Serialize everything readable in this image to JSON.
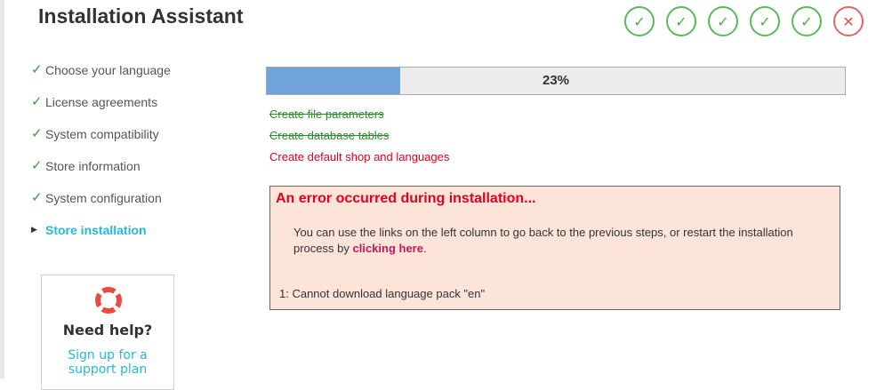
{
  "header": {
    "title": "Installation Assistant"
  },
  "step_icons": [
    {
      "icon": "check-circle-icon",
      "glyph": "✓",
      "status": "done"
    },
    {
      "icon": "check-circle-icon",
      "glyph": "✓",
      "status": "done"
    },
    {
      "icon": "check-circle-icon",
      "glyph": "✓",
      "status": "done"
    },
    {
      "icon": "check-circle-icon",
      "glyph": "✓",
      "status": "done"
    },
    {
      "icon": "check-circle-icon",
      "glyph": "✓",
      "status": "done"
    },
    {
      "icon": "close-circle-icon",
      "glyph": "✕",
      "status": "error"
    }
  ],
  "sidebar": {
    "steps": [
      {
        "label": "Choose your language",
        "status": "done"
      },
      {
        "label": "License agreements",
        "status": "done"
      },
      {
        "label": "System compatibility",
        "status": "done"
      },
      {
        "label": "Store information",
        "status": "done"
      },
      {
        "label": "System configuration",
        "status": "done"
      },
      {
        "label": "Store installation",
        "status": "active"
      }
    ]
  },
  "help": {
    "title": "Need help?",
    "link_line1": "Sign up for a",
    "link_line2": "support plan"
  },
  "progress": {
    "fraction": 0.23,
    "label": "23%"
  },
  "tasks": [
    {
      "label": "Create file parameters",
      "status": "done"
    },
    {
      "label": "Create database tables",
      "status": "done"
    },
    {
      "label": "Create default shop and languages",
      "status": "failed"
    }
  ],
  "error": {
    "title": "An error occurred during installation...",
    "message": "You can use the links on the left column to go back to the previous steps, or restart the installation process by",
    "link_text": "clicking here",
    "message_end": ".",
    "detail": "1: Cannot download language pack \"en\""
  },
  "colors": {
    "success": "#5cb85c",
    "error": "#e5001b",
    "accent": "#25b9d7",
    "progress_fill": "#6fa3d9",
    "error_bg": "#fde4d9"
  }
}
